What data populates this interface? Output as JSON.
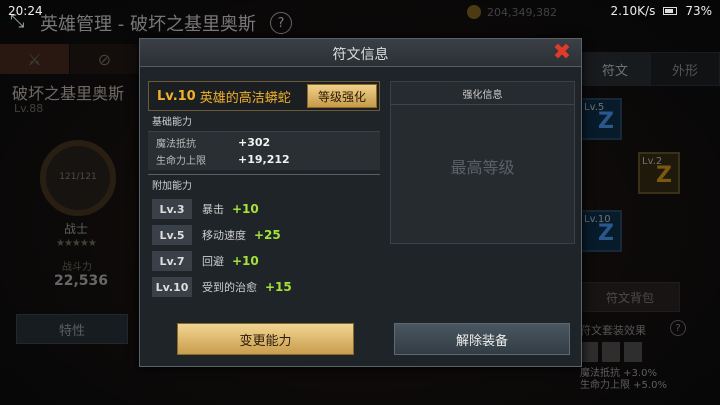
{
  "status": {
    "time": "20:24",
    "net_speed": "2.10K/s",
    "battery": "73%"
  },
  "background": {
    "title": "英雄管理 - 破坏之基里奥斯",
    "gold": "204,349,382",
    "hero_name": "破坏之基里奥斯",
    "hero_level": "Lv.88",
    "class_progress": "121/121",
    "class_name": "战士",
    "power_label": "战斗力",
    "power_value": "22,536",
    "trait_button": "特性",
    "tab_rune": "符文",
    "tab_appearance": "外形",
    "rune_slots": [
      {
        "level": "Lv.5",
        "glyph": "Z",
        "color": "blue"
      },
      {
        "level": "Lv.2",
        "glyph": "Z",
        "color": "gold"
      },
      {
        "level": "Lv.10",
        "glyph": "Z",
        "color": "blue"
      }
    ],
    "bag_button": "符文背包",
    "set_title": "符文套装效果",
    "set_bonus_lines": [
      "魔法抵抗 +3.0%",
      "生命力上限 +5.0%"
    ]
  },
  "dialog": {
    "title": "符文信息",
    "rune": {
      "level": "Lv.10",
      "name": "英雄的高洁蟒蛇",
      "upgrade_button": "等级强化"
    },
    "basic_label": "基础能力",
    "basic_stats": [
      {
        "name": "魔法抵抗",
        "value": "+302"
      },
      {
        "name": "生命力上限",
        "value": "+19,212"
      }
    ],
    "extra_label": "附加能力",
    "extra_stats": [
      {
        "level": "Lv.3",
        "name": "暴击",
        "value": "+10"
      },
      {
        "level": "Lv.5",
        "name": "移动速度",
        "value": "+25"
      },
      {
        "level": "Lv.7",
        "name": "回避",
        "value": "+10"
      },
      {
        "level": "Lv.10",
        "name": "受到的治愈",
        "value": "+15"
      }
    ],
    "enhance_title": "强化信息",
    "max_level_text": "最高等级",
    "change_button": "变更能力",
    "unequip_button": "解除装备"
  },
  "colors": {
    "accent_gold": "#f1b12a",
    "bonus_green": "#a6e23a",
    "close_red": "#e23a2a"
  }
}
